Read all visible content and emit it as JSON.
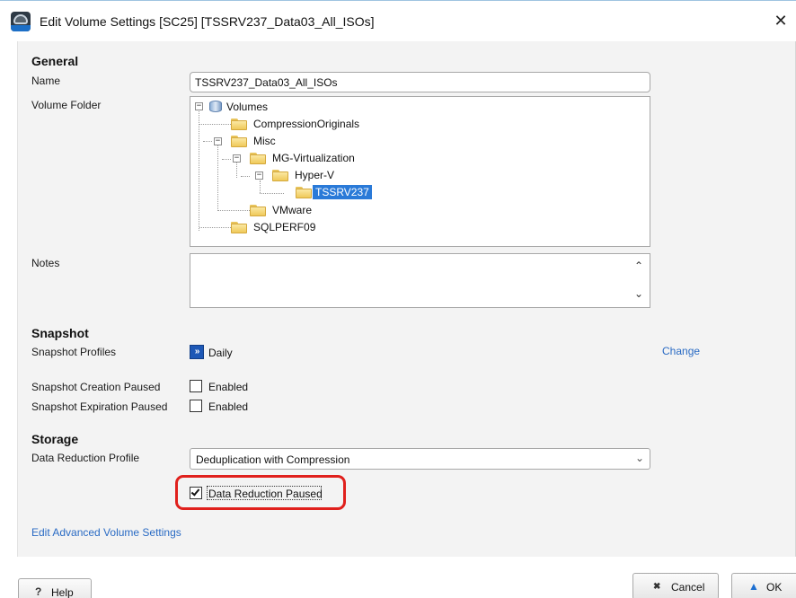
{
  "window": {
    "title": "Edit Volume Settings [SC25] [TSSRV237_Data03_All_ISOs]",
    "close_glyph": "✕"
  },
  "general": {
    "header": "General",
    "name_label": "Name",
    "name_value": "TSSRV237_Data03_All_ISOs",
    "folder_label": "Volume Folder",
    "tree": {
      "root": "Volumes",
      "compression_originals": "CompressionOriginals",
      "misc": "Misc",
      "mg_virtualization": "MG-Virtualization",
      "hyper_v": "Hyper-V",
      "tssrv237": "TSSRV237",
      "vmware": "VMware",
      "sqlperf09": "SQLPERF09",
      "expanded_glyph": "−"
    },
    "notes_label": "Notes",
    "notes_value": "",
    "scroll_up": "⌃",
    "scroll_down": "⌄"
  },
  "snapshot": {
    "header": "Snapshot",
    "profiles_label": "Snapshot Profiles",
    "profile_icon_glyph": "»",
    "profile_value": "Daily",
    "change_link": "Change",
    "creation_paused_label": "Snapshot Creation Paused",
    "creation_paused_enabled_text": "Enabled",
    "creation_paused_checked": false,
    "expiration_paused_label": "Snapshot Expiration Paused",
    "expiration_paused_enabled_text": "Enabled",
    "expiration_paused_checked": false
  },
  "storage": {
    "header": "Storage",
    "data_reduction_label": "Data Reduction Profile",
    "data_reduction_value": "Deduplication with Compression",
    "dropdown_chevron": "⌄",
    "data_reduction_paused_label": "Data Reduction Paused",
    "data_reduction_paused_checked": true,
    "highlight_color": "#e0201c"
  },
  "advanced_link": "Edit Advanced Volume Settings",
  "footer": {
    "help_icon": "?",
    "help_label": "Help",
    "cancel_icon": "✖",
    "cancel_label": "Cancel",
    "ok_icon": "▲",
    "ok_label": "OK"
  },
  "colors": {
    "link": "#2a6bc4",
    "selection": "#2a7ad8",
    "panel": "#f3f3f3"
  }
}
